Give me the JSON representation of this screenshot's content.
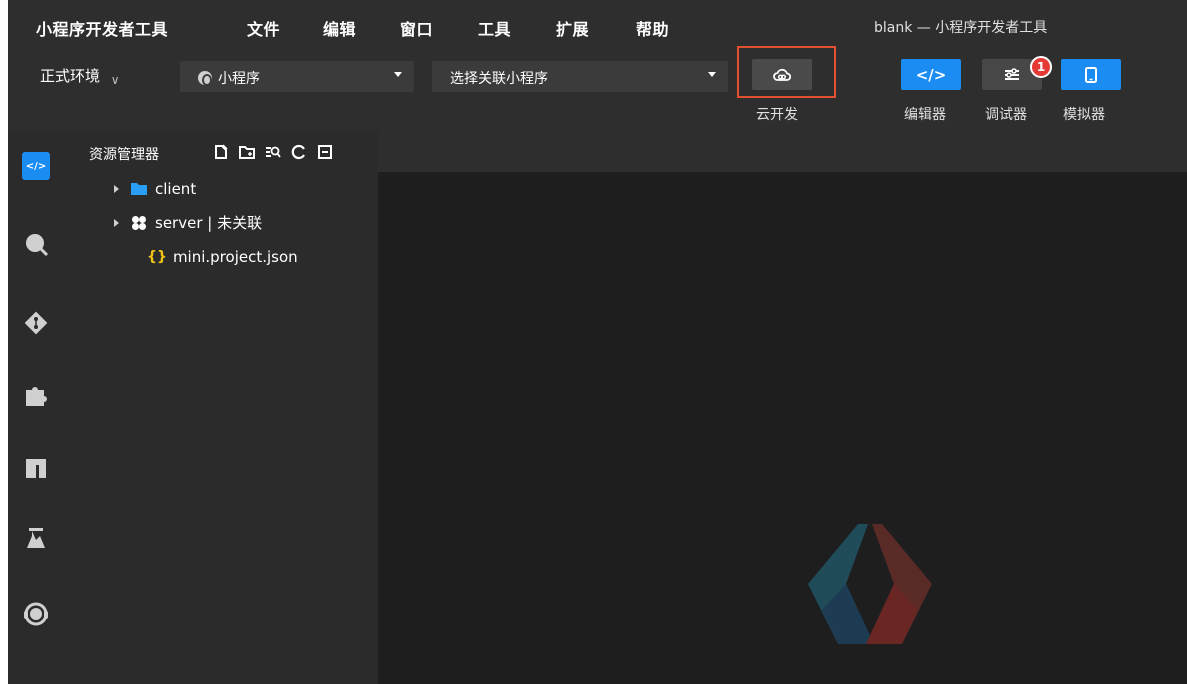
{
  "menubar": {
    "items": [
      "小程序开发者工具",
      "文件",
      "编辑",
      "窗口",
      "工具",
      "扩展",
      "帮助"
    ],
    "window_title": "blank — 小程序开发者工具"
  },
  "toolbar": {
    "env_label": "正式环境",
    "project_select": "小程序",
    "link_select": "选择关联小程序",
    "cloud_label": "云开发",
    "editor_label": "编辑器",
    "debugger_label": "调试器",
    "simulator_label": "模拟器",
    "debugger_badge": "1",
    "highlight_color": "#e2512f",
    "accent_color": "#1b8cf2"
  },
  "activitybar": {
    "icons": [
      "code-icon",
      "search-icon",
      "git-icon",
      "extension-icon",
      "library-icon",
      "test-flask-icon",
      "support-headset-icon"
    ]
  },
  "explorer": {
    "title": "资源管理器",
    "tools": [
      "new-file-icon",
      "new-folder-icon",
      "search-files-icon",
      "refresh-icon",
      "collapse-all-icon"
    ],
    "tree": [
      {
        "label": "client",
        "type": "folder"
      },
      {
        "label": "server | 未关联",
        "type": "cloud-folder"
      },
      {
        "label": "mini.project.json",
        "type": "json-file"
      }
    ]
  }
}
